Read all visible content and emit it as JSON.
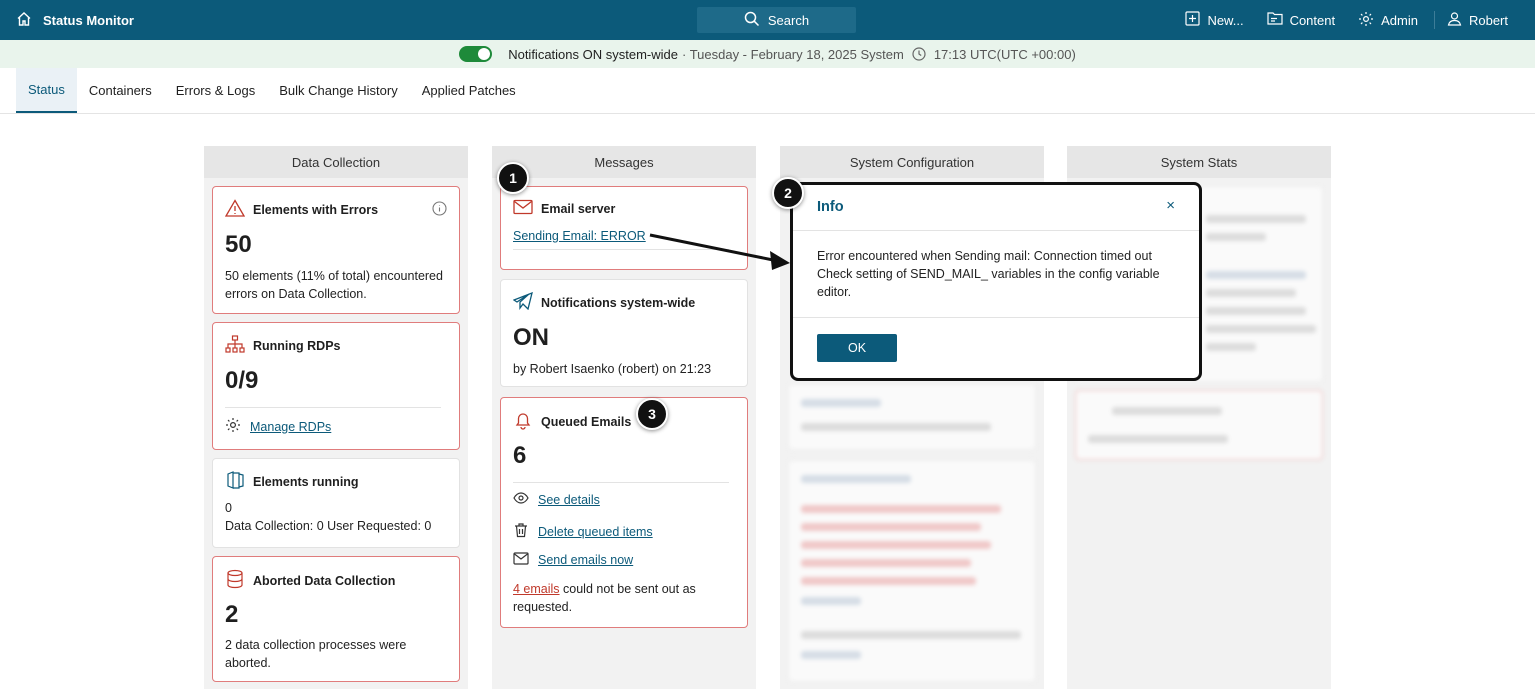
{
  "app": {
    "title": "Status Monitor"
  },
  "search": {
    "label": "Search"
  },
  "topnav": {
    "new": "New...",
    "content": "Content",
    "admin": "Admin",
    "user": "Robert"
  },
  "notif": {
    "text": "Notifications ON system-wide",
    "date": "· Tuesday - February 18, 2025 System",
    "time": "17:13 UTC(UTC +00:00)",
    "toggle_on": true
  },
  "tabs": [
    {
      "label": "Status",
      "active": true
    },
    {
      "label": "Containers"
    },
    {
      "label": "Errors & Logs"
    },
    {
      "label": "Bulk Change History"
    },
    {
      "label": "Applied Patches"
    }
  ],
  "columns": {
    "data_collection": "Data Collection",
    "messages": "Messages",
    "system_configuration": "System Configuration",
    "system_stats": "System Stats"
  },
  "cards": {
    "elements_errors": {
      "title": "Elements with Errors",
      "value": "50",
      "desc": "50 elements (11% of total) encountered errors on Data Collection."
    },
    "running_rdps": {
      "title": "Running RDPs",
      "value": "0/9",
      "link": "Manage RDPs"
    },
    "elements_running": {
      "title": "Elements running",
      "value": "0",
      "desc": "Data Collection: 0 User Requested: 0"
    },
    "aborted": {
      "title": "Aborted Data Collection",
      "value": "2",
      "desc": "2 data collection processes were aborted."
    },
    "email_server": {
      "title": "Email server",
      "link": "Sending Email: ERROR"
    },
    "notifications": {
      "title": "Notifications system-wide",
      "value": "ON",
      "desc": "by Robert Isaenko (robert) on 21:23"
    },
    "queued": {
      "title": "Queued Emails",
      "value": "6",
      "see_details": "See details",
      "delete": "Delete queued items",
      "send": "Send emails now",
      "failed_link": "4 emails",
      "failed_text": "could not be sent out as requested."
    }
  },
  "modal": {
    "title": "Info",
    "close": "×",
    "body": "Error encountered when Sending mail: Connection timed out Check setting of SEND_MAIL_ variables in the config variable editor.",
    "ok": "OK"
  },
  "badges": [
    "1",
    "2",
    "3"
  ],
  "colors": {
    "primary": "#0c5a7a",
    "error": "#c0392b",
    "toggle": "#1e8a3a",
    "notif_bg": "#e9f4ec"
  }
}
